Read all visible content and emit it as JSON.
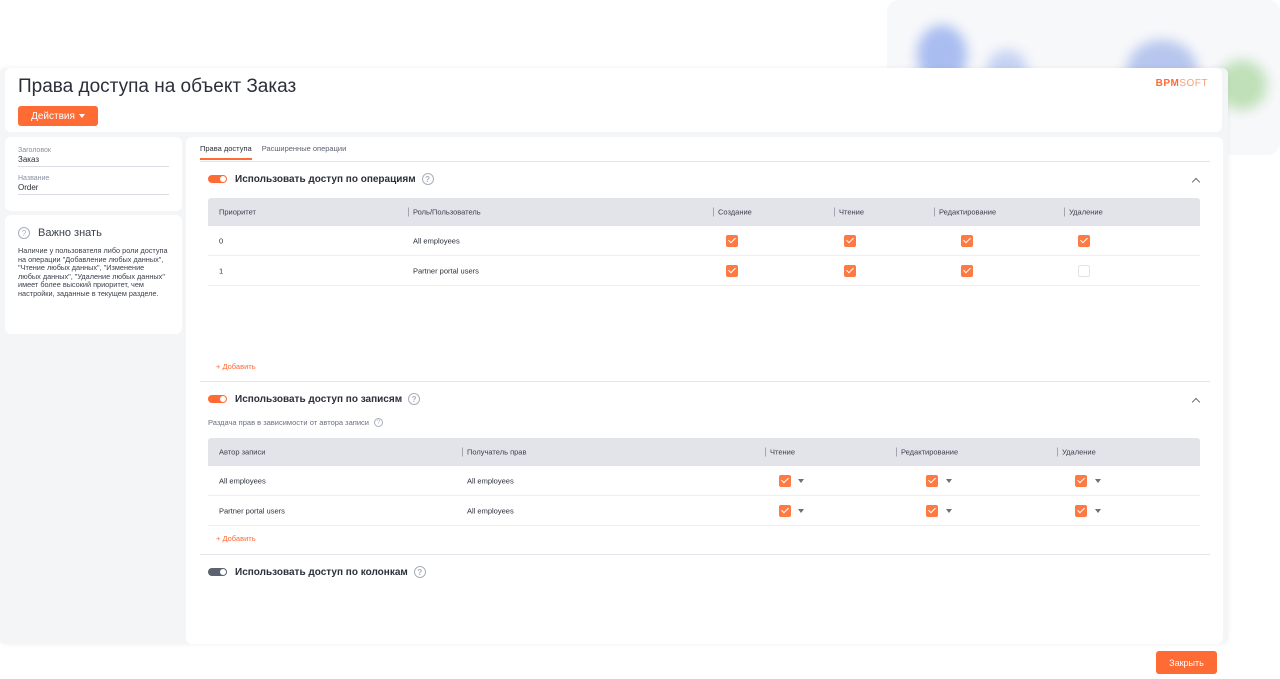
{
  "header": {
    "title": "Права доступа на объект Заказ",
    "actions_label": "Действия",
    "logo_main": "BPM",
    "logo_sub": "SOFT"
  },
  "left_panel": {
    "fields": [
      {
        "caption": "Заголовок",
        "value": "Заказ"
      },
      {
        "caption": "Название",
        "value": "Order"
      }
    ]
  },
  "info": {
    "title": "Важно знать",
    "text": "Наличие у пользователя либо роли доступа на операции \"Добавление любых данных\", \"Чтение любых данных\", \"Изменение любых данных\", \"Удаление любых данных\" имеет более высокий приоритет, чем настройки, заданные в текущем разделе."
  },
  "tabs": [
    {
      "label": "Права доступа",
      "active": true
    },
    {
      "label": "Расширенные операции",
      "active": false
    }
  ],
  "operations": {
    "title": "Использовать доступ по операциям",
    "enabled": true,
    "columns": [
      "Приоритет",
      "Роль/Пользователь",
      "Создание",
      "Чтение",
      "Редактирование",
      "Удаление"
    ],
    "rows": [
      {
        "priority": "0",
        "role": "All employees",
        "create": true,
        "read": true,
        "edit": true,
        "delete": true
      },
      {
        "priority": "1",
        "role": "Partner portal users",
        "create": true,
        "read": true,
        "edit": true,
        "delete": false
      }
    ],
    "add_label": "+ Добавить"
  },
  "records": {
    "title": "Использовать доступ по записям",
    "enabled": true,
    "subtitle": "Раздача прав в зависимости от автора записи",
    "columns": [
      "Автор записи",
      "Получатель прав",
      "Чтение",
      "Редактирование",
      "Удаление"
    ],
    "rows": [
      {
        "author": "All employees",
        "grantee": "All employees",
        "read": true,
        "edit": true,
        "delete": true
      },
      {
        "author": "Partner portal users",
        "grantee": "All employees",
        "read": true,
        "edit": true,
        "delete": true
      }
    ],
    "add_label": "+ Добавить"
  },
  "columns_access": {
    "title": "Использовать доступ по колонкам",
    "enabled": false
  },
  "footer": {
    "close_label": "Закрыть"
  },
  "colors": {
    "accent": "#ff6b35",
    "grid_header": "#e2e4ea"
  }
}
